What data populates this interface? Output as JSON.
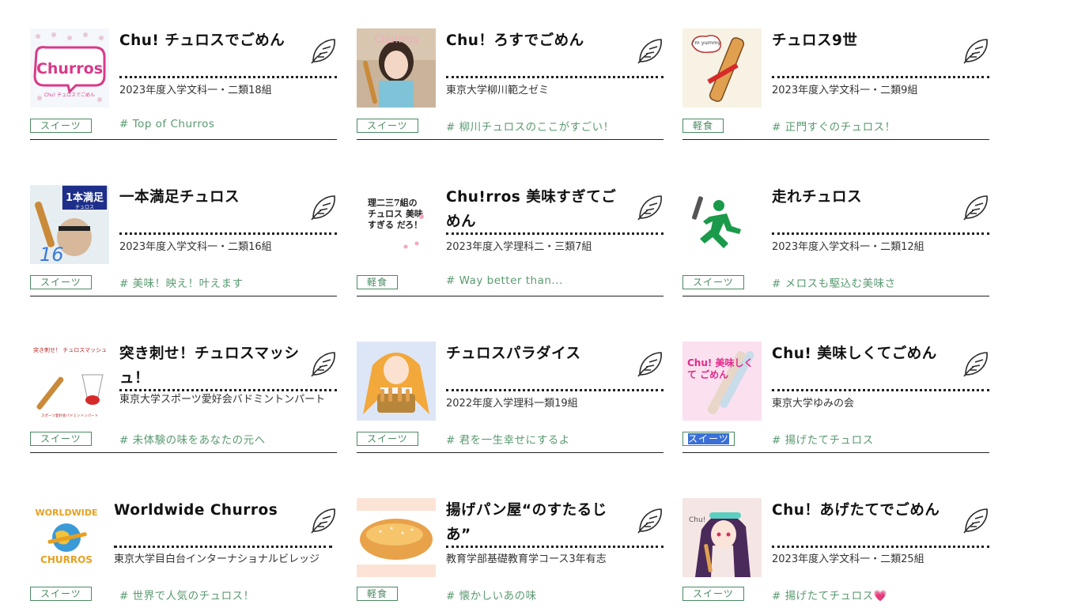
{
  "cards": [
    {
      "title": "Chu! チュロスでごめん",
      "sub": "2023年度入学文科一・二類18組",
      "tag": "スイーツ",
      "hash": "# Top of Churros",
      "thumb": "churros-logo-thumbnail",
      "thumb_text": "Churros",
      "thumb_caption": "Chu! チュロスでごめん"
    },
    {
      "title": "Chu！ろすでごめん",
      "sub": "東京大学柳川範之ゼミ",
      "tag": "スイーツ",
      "hash": "# 柳川チュロスのここがすごい！",
      "thumb": "girl-with-churro-thumbnail",
      "thumb_text": "Chu!rros"
    },
    {
      "title": "チュロス9世",
      "sub": "2023年度入学文科一・二類9組",
      "tag": "軽食",
      "hash": "# 正門すぐのチュロス！",
      "thumb": "churro-character-thumbnail",
      "thumb_text": "I'm yummy"
    },
    {
      "title": "一本満足チュロス",
      "sub": "2023年度入学文科一・二類16組",
      "tag": "スイーツ",
      "hash": "# 美味！映え！叶えます",
      "thumb": "man-eating-churro-thumbnail",
      "thumb_text": "1本満足",
      "thumb_caption": "チュロス"
    },
    {
      "title": "Chu!rros 美味すぎてごめん",
      "sub": "2023年度入学理科二・三類7組",
      "tag": "軽食",
      "hash": "# Way better than...",
      "thumb": "calligraphy-thumbnail",
      "thumb_text": "理二三7組の チュロス 美味すぎる だろ！"
    },
    {
      "title": "走れチュロス",
      "sub": "2023年度入学文科一・二類12組",
      "tag": "スイーツ",
      "hash": "# メロスも駆込む美味さ",
      "thumb": "running-man-thumbnail"
    },
    {
      "title": "突き刺せ！チュロスマッシュ！",
      "sub": "東京大学スポーツ愛好会バドミントンパート",
      "tag": "スイーツ",
      "hash": "# 未体験の味をあなたの元へ",
      "thumb": "badminton-churro-thumbnail",
      "thumb_text": "突き刺せ！ チュロスマッシュ",
      "thumb_caption": "スポーツ愛好会バドミントンパート"
    },
    {
      "title": "チュロスパラダイス",
      "sub": "2022年度入学理科一類19組",
      "tag": "スイーツ",
      "hash": "# 君を一生幸せにするよ",
      "thumb": "anime-girl-basket-thumbnail"
    },
    {
      "title": "Chu! 美味しくてごめん",
      "sub": "東京大学ゆみの会",
      "tag": "スイーツ",
      "hash": "# 揚げたてチュロス",
      "thumb": "pink-churro-thumbnail",
      "thumb_text": "Chu! 美味しくて ごめん",
      "selected": true
    },
    {
      "title": "Worldwide Churros",
      "sub": "東京大学目白台インターナショナルビレッジ",
      "tag": "スイーツ",
      "hash": "# 世界で人気のチュロス！",
      "thumb": "worldwide-logo-thumbnail",
      "thumb_text": "WORLDWIDE",
      "thumb_caption": "CHURROS"
    },
    {
      "title": "揚げパン屋“のすたるじあ”",
      "sub": "教育学部基礎教育学コース3年有志",
      "tag": "軽食",
      "hash": "# 懐かしいあの味",
      "thumb": "fried-bread-thumbnail"
    },
    {
      "title": "Chu！あげたてでごめん",
      "sub": "2023年度入学文科一・二類25組",
      "tag": "スイーツ",
      "hash": "# 揚げたてチュロス💗",
      "thumb": "anime-girl-churro-thumbnail",
      "thumb_text": "Chu!"
    }
  ],
  "colors": {
    "tag_green": "#4a8a62",
    "hash_green": "#5a9a70",
    "selection_blue": "#3a6fd8"
  },
  "icon": "feather-icon"
}
